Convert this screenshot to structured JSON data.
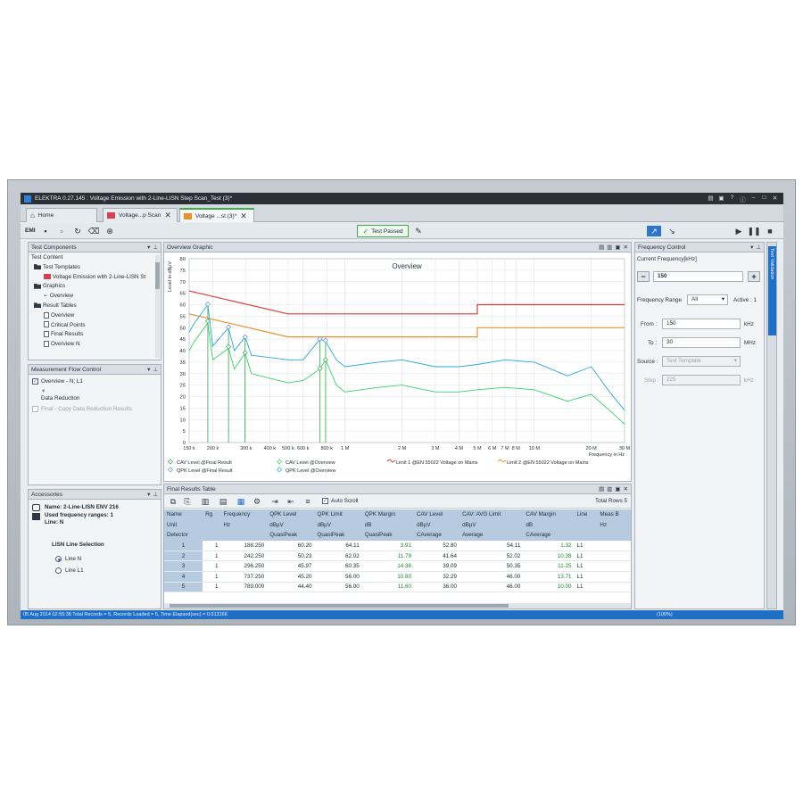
{
  "window": {
    "title": "ELEKTRA 0.27.145 : Voltage Emission with 2-Line-LISN Step Scan_Test (3)*"
  },
  "tabs": [
    {
      "label": "Home"
    },
    {
      "label": "Voltage...p Scan"
    },
    {
      "label": "Voltage ...st (3)*"
    }
  ],
  "toolbar": {
    "emi_label": "EMI",
    "status_label": "Test Passed"
  },
  "test_components": {
    "title": "Test Components",
    "nodes": [
      "Test Content",
      "Test Templates",
      "Voltage Emission with 2-Line-LISN St",
      "Graphics",
      "Overview",
      "Result Tables",
      "Overview",
      "Critical Points",
      "Final Results",
      "Overview N"
    ]
  },
  "flow_control": {
    "title": "Measurement Flow Control",
    "items": [
      "Overview - N; L1",
      "Data Reduction",
      "Final - Copy Data Reduction Results"
    ]
  },
  "accessories": {
    "title": "Accessories",
    "name_line": "Name: 2-Line-LISN ENV 216",
    "ranges_line": "Used frequency ranges: 1",
    "line_line": "Line: N",
    "selection_title": "LISN Line Selection",
    "options": [
      "Line N",
      "Line L1"
    ]
  },
  "graphic": {
    "panel_title": "Overview Graphic",
    "chart_title": "Overview"
  },
  "chart_data": {
    "type": "line",
    "title": "Overview",
    "xlabel": "Frequency in Hz",
    "ylabel": "Level in dBµV",
    "x_scale": "log",
    "xlim": [
      150000,
      30000000
    ],
    "ylim": [
      0,
      80
    ],
    "y_ticks": [
      0,
      5,
      10,
      15,
      20,
      25,
      30,
      35,
      40,
      45,
      50,
      55,
      60,
      65,
      70,
      75,
      80
    ],
    "x_ticks": [
      150000,
      200000,
      300000,
      400000,
      500000,
      600000,
      800000,
      1000000,
      2000000,
      3000000,
      4000000,
      5000000,
      6000000,
      7000000,
      8000000,
      10000000,
      20000000,
      30000000
    ],
    "x_tick_labels": [
      "150 k",
      "200 k",
      "300 k",
      "400 k",
      "500 k",
      "600 k",
      "800 k",
      "1 M",
      "2 M",
      "3 M",
      "4 M",
      "5 M",
      "6 M",
      "7 M",
      "8 M",
      "10 M",
      "20 M",
      "30 M"
    ],
    "grid": true,
    "legend_position": "bottom",
    "series": [
      {
        "name": "Limit 1 @EN 55022 Voltage on Mains",
        "color": "#d93b3b",
        "x": [
          150000,
          500000,
          5000000,
          5000000,
          30000000
        ],
        "y": [
          66,
          56,
          56,
          60,
          60
        ]
      },
      {
        "name": "Limit 2 @EN 55022 Voltage on Mains",
        "color": "#e8902e",
        "x": [
          150000,
          500000,
          5000000,
          5000000,
          30000000
        ],
        "y": [
          56,
          46,
          46,
          50,
          50
        ]
      },
      {
        "name": "CAV Level @Overview",
        "color": "#3ad06a",
        "x": [
          150000,
          160000,
          188250,
          200000,
          242250,
          260000,
          296250,
          320000,
          400000,
          500000,
          600000,
          737250,
          789000,
          900000,
          1000000,
          1500000,
          2000000,
          3000000,
          4000000,
          5000000,
          7000000,
          10000000,
          15000000,
          20000000,
          25000000,
          30000000
        ],
        "y": [
          40,
          44,
          52,
          36,
          41,
          32,
          39,
          30,
          28,
          26,
          27,
          32,
          36,
          25,
          22,
          24,
          25,
          22,
          22,
          23,
          24,
          23,
          18,
          21,
          14,
          8
        ]
      },
      {
        "name": "QPK Level @Overview",
        "color": "#2aa7d9",
        "x": [
          150000,
          160000,
          188250,
          200000,
          242250,
          260000,
          296250,
          320000,
          400000,
          500000,
          600000,
          737250,
          789000,
          900000,
          1000000,
          1500000,
          2000000,
          3000000,
          4000000,
          5000000,
          7000000,
          10000000,
          15000000,
          20000000,
          25000000,
          30000000
        ],
        "y": [
          48,
          52,
          60,
          42,
          50,
          40,
          46,
          38,
          37,
          36,
          36,
          45,
          44,
          36,
          33,
          35,
          36,
          33,
          33,
          34,
          36,
          35,
          29,
          33,
          22,
          14
        ]
      },
      {
        "name": "CAV Level @Final Result",
        "color": "#2ea84a",
        "x": [
          188250,
          242250,
          296250,
          737250,
          789000
        ],
        "y": [
          52.8,
          41.64,
          39.09,
          32.29,
          36.0
        ]
      },
      {
        "name": "QPK Level @Final Result",
        "color": "#6a8fd6",
        "x": [
          188250,
          242250,
          296250,
          737250,
          789000
        ],
        "y": [
          60.2,
          50.23,
          45.97,
          45.2,
          44.4
        ]
      }
    ]
  },
  "final_results": {
    "panel_title": "Final Results Table",
    "auto_scroll_label": "Auto Scroll",
    "total_rows_label": "Total Rows",
    "total_rows": "5",
    "header_names": [
      "Name",
      "Rg",
      "Frequency",
      "QPK Level",
      "QPK Limit",
      "QPK Margin",
      "CAV Level",
      "CAV: AVG Limit",
      "CAV Margin",
      "Line",
      "Meas B"
    ],
    "header_units_label": "Unit",
    "header_units": [
      "",
      "Hz",
      "dBµV",
      "dBµV",
      "dB",
      "dBµV",
      "dBµV",
      "dB",
      "",
      "Hz"
    ],
    "header_detector_label": "Detector",
    "header_detectors": [
      "",
      "",
      "QuasiPeak",
      "QuasiPeak",
      "QuasiPeak",
      "CAverage",
      "Average",
      "CAverage",
      "",
      ""
    ],
    "rows": [
      {
        "n": "1",
        "rg": "1",
        "freq": "188.250",
        "qpk": "60.20",
        "qpklim": "64.11",
        "qpkm": "3.91",
        "cav": "52.80",
        "cavlim": "54.11",
        "cavm": "1.32",
        "line": "L1"
      },
      {
        "n": "2",
        "rg": "1",
        "freq": "242.250",
        "qpk": "50.23",
        "qpklim": "62.02",
        "qpkm": "11.79",
        "cav": "41.64",
        "cavlim": "52.02",
        "cavm": "10.38",
        "line": "L1"
      },
      {
        "n": "3",
        "rg": "1",
        "freq": "296.250",
        "qpk": "45.97",
        "qpklim": "60.35",
        "qpkm": "14.38",
        "cav": "39.09",
        "cavlim": "50.35",
        "cavm": "11.25",
        "line": "L1"
      },
      {
        "n": "4",
        "rg": "1",
        "freq": "737.250",
        "qpk": "45.20",
        "qpklim": "56.00",
        "qpkm": "10.80",
        "cav": "32.29",
        "cavlim": "46.00",
        "cavm": "13.71",
        "line": "L1"
      },
      {
        "n": "5",
        "rg": "1",
        "freq": "789.000",
        "qpk": "44.40",
        "qpklim": "56.00",
        "qpkm": "11.60",
        "cav": "36.00",
        "cavlim": "46.00",
        "cavm": "10.00",
        "line": "L1"
      }
    ]
  },
  "frequency_control": {
    "title": "Frequency Control",
    "current_label": "Current Frequency[kHz]",
    "current_value": "150",
    "range_label": "Frequency Range",
    "range_value": "All",
    "active_label": "Active : 1",
    "from_label": "From :",
    "from_value": "150",
    "from_unit": "kHz",
    "to_label": "To :",
    "to_value": "30",
    "to_unit": "MHz",
    "source_label": "Source :",
    "source_value": "Test Template",
    "step_label": "Step :",
    "step_value": "225",
    "step_unit": "kHz",
    "side_tab": "Test Validation"
  },
  "status_bar": {
    "text": "05 Aug 2014 02:55:38     Total Records = 5, Records Loaded = 5, Time Elapsed(sec) = 0.013166",
    "zoom": "(100%)"
  },
  "colors": {
    "accent_blue": "#1f6fc6",
    "pass_green": "#3fae49",
    "limit_red": "#d93b3b",
    "limit_orange": "#e8902e"
  }
}
